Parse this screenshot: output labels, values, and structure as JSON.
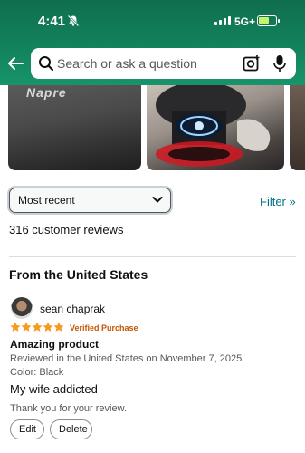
{
  "status_bar": {
    "time": "4:41",
    "network": "5G+"
  },
  "search": {
    "placeholder": "Search or ask a question"
  },
  "carousel": {
    "brand_text": "Napre"
  },
  "sort": {
    "selected": "Most recent"
  },
  "filter_label": "Filter »",
  "review_count": "316 customer reviews",
  "section_title": "From the United States",
  "review": {
    "reviewer": "sean chaprak",
    "rating": 5,
    "verified": "Verified Purchase",
    "title": "Amazing product",
    "date": "Reviewed in the United States on November 7, 2025",
    "color": "Color: Black",
    "body": "My wife addicted",
    "thanks": "Thank you for your review.",
    "edit_label": "Edit",
    "delete_label": "Delete"
  },
  "colors": {
    "header_green": "#13845d",
    "link": "#007185",
    "star": "#f79a1e",
    "verified": "#c45500"
  },
  "icons": [
    "bell-slash-icon",
    "signal-icon",
    "battery-icon",
    "back-arrow-icon",
    "search-icon",
    "camera-icon",
    "mic-icon",
    "chevron-down-icon",
    "star-icon"
  ]
}
